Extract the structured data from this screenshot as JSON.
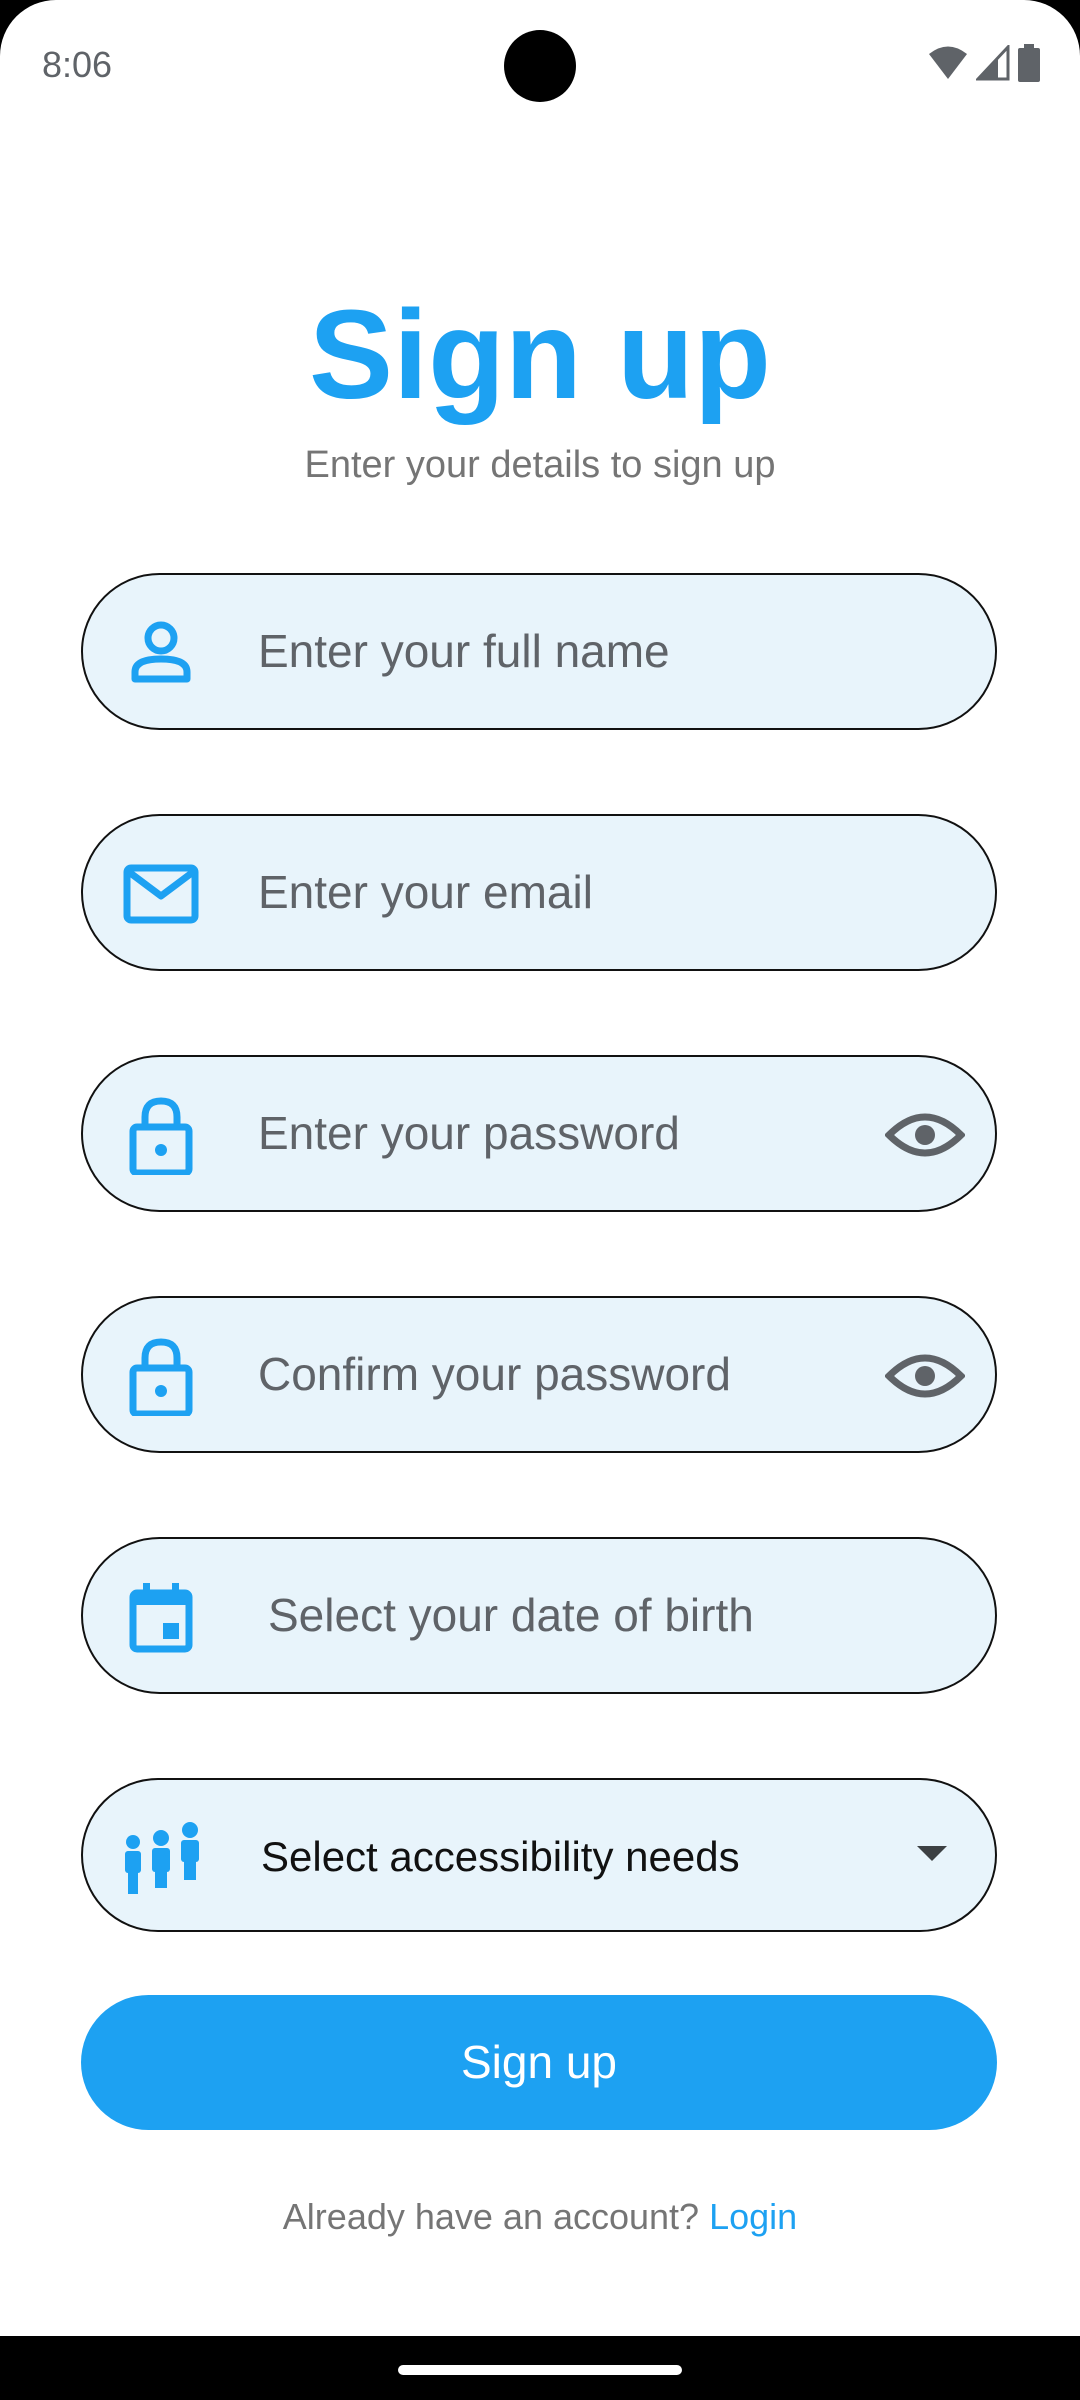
{
  "status": {
    "time": "8:06"
  },
  "header": {
    "title": "Sign up",
    "subtitle": "Enter your details to sign up"
  },
  "form": {
    "full_name": {
      "placeholder": "Enter your full name",
      "icon": "person-icon"
    },
    "email": {
      "placeholder": "Enter your email",
      "icon": "mail-icon"
    },
    "password": {
      "placeholder": "Enter your password",
      "icon": "lock-icon",
      "toggle_icon": "eye-icon"
    },
    "confirm_password": {
      "placeholder": "Confirm your password",
      "icon": "lock-icon",
      "toggle_icon": "eye-icon"
    },
    "dob": {
      "placeholder": "Select your date of birth",
      "icon": "calendar-icon"
    },
    "accessibility": {
      "value": "Select accessibility needs",
      "icon": "people-icon",
      "dropdown_icon": "caret-down-icon"
    }
  },
  "actions": {
    "signup_label": "Sign up",
    "login_prompt": "Already have an account?",
    "login_link": "Login"
  },
  "colors": {
    "accent": "#1da1f2",
    "field_bg": "#e8f4fb"
  }
}
